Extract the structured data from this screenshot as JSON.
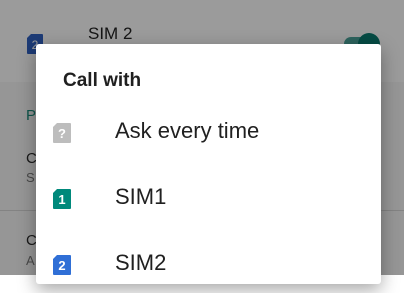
{
  "background": {
    "sim_label": "SIM 2",
    "sim_icon_number": "2",
    "letters": [
      "P",
      "C",
      "S",
      "C",
      "A"
    ]
  },
  "dialog": {
    "title": "Call with",
    "options": [
      {
        "label": "Ask every time",
        "icon": "question-sim-icon",
        "icon_text": "?",
        "color": "#bdbdbd"
      },
      {
        "label": "SIM1",
        "icon": "sim1-icon",
        "icon_text": "1",
        "color": "#00897b"
      },
      {
        "label": "SIM2",
        "icon": "sim2-icon",
        "icon_text": "2",
        "color": "#2f6fd6"
      }
    ]
  },
  "colors": {
    "scrim": "rgba(0,0,0,0.38)",
    "toggle_on": "#0b7a6e"
  }
}
